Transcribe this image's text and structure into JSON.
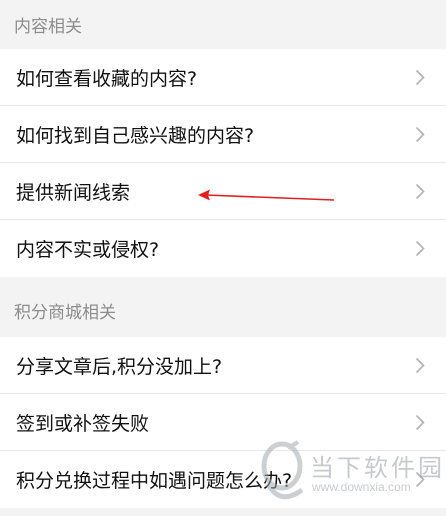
{
  "sections": [
    {
      "title": "内容相关",
      "items": [
        {
          "label": "如何查看收藏的内容?"
        },
        {
          "label": "如何找到自己感兴趣的内容?"
        },
        {
          "label": "提供新闻线索"
        },
        {
          "label": "内容不实或侵权?"
        }
      ]
    },
    {
      "title": "积分商城相关",
      "items": [
        {
          "label": "分享文章后,积分没加上?"
        },
        {
          "label": "签到或补签失败"
        },
        {
          "label": "积分兑换过程中如遇问题怎么办?"
        }
      ]
    }
  ],
  "annotation": {
    "icon": "red-arrow-icon",
    "color": "#e02020"
  },
  "watermark": {
    "title": "当下软件园",
    "url": "www.downxia.com"
  },
  "colors": {
    "background": "#f3f3f3",
    "row": "#ffffff",
    "header_text": "#8c8c8c",
    "text": "#111111",
    "divider": "#e6e6e6"
  }
}
